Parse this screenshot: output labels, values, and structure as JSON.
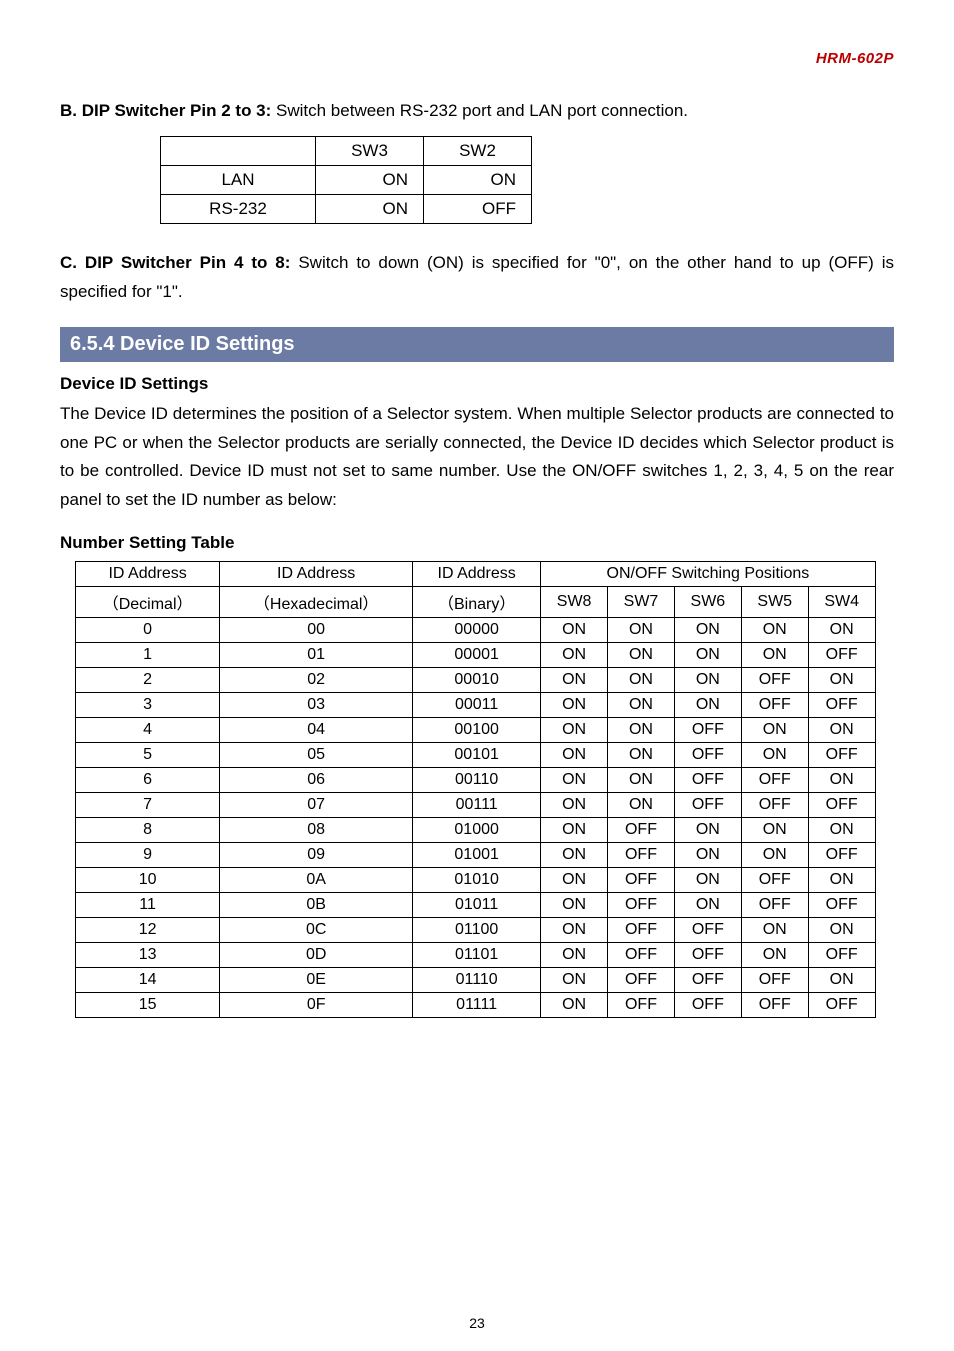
{
  "header": {
    "product": "HRM-602P"
  },
  "sectionB": {
    "title": "B. DIP Switcher Pin 2 to 3: ",
    "desc": "Switch between RS-232 port and LAN port connection.",
    "table": {
      "cols": [
        "",
        "SW3",
        "SW2"
      ],
      "rows": [
        [
          "LAN",
          "ON",
          "ON"
        ],
        [
          "RS-232",
          "ON",
          "OFF"
        ]
      ]
    }
  },
  "sectionC": {
    "title": "C. DIP Switcher Pin 4 to 8: ",
    "desc": "Switch to down (ON) is specified for \"0\", on the other hand to up (OFF) is specified for \"1\"."
  },
  "sectionBar": "6.5.4 Device ID Settings",
  "deviceId": {
    "heading": "Device ID Settings",
    "text": "The Device ID determines the position of a Selector system. When multiple Selector products are connected to one PC or when the Selector products are serially connected, the Device ID decides which Selector product is to be controlled. Device ID must not set to same number. Use the ON/OFF switches 1, 2, 3, 4, 5 on the rear panel to set the ID number as below:"
  },
  "numberTable": {
    "title": "Number Setting Table",
    "header1": [
      "ID Address",
      "ID Address",
      "ID Address",
      "ON/OFF Switching Positions"
    ],
    "header2": [
      "（Decimal）",
      "（Hexadecimal）",
      "（Binary）",
      "SW8",
      "SW7",
      "SW6",
      "SW5",
      "SW4"
    ],
    "rows": [
      [
        "0",
        "00",
        "00000",
        "ON",
        "ON",
        "ON",
        "ON",
        "ON"
      ],
      [
        "1",
        "01",
        "00001",
        "ON",
        "ON",
        "ON",
        "ON",
        "OFF"
      ],
      [
        "2",
        "02",
        "00010",
        "ON",
        "ON",
        "ON",
        "OFF",
        "ON"
      ],
      [
        "3",
        "03",
        "00011",
        "ON",
        "ON",
        "ON",
        "OFF",
        "OFF"
      ],
      [
        "4",
        "04",
        "00100",
        "ON",
        "ON",
        "OFF",
        "ON",
        "ON"
      ],
      [
        "5",
        "05",
        "00101",
        "ON",
        "ON",
        "OFF",
        "ON",
        "OFF"
      ],
      [
        "6",
        "06",
        "00110",
        "ON",
        "ON",
        "OFF",
        "OFF",
        "ON"
      ],
      [
        "7",
        "07",
        "00111",
        "ON",
        "ON",
        "OFF",
        "OFF",
        "OFF"
      ],
      [
        "8",
        "08",
        "01000",
        "ON",
        "OFF",
        "ON",
        "ON",
        "ON"
      ],
      [
        "9",
        "09",
        "01001",
        "ON",
        "OFF",
        "ON",
        "ON",
        "OFF"
      ],
      [
        "10",
        "0A",
        "01010",
        "ON",
        "OFF",
        "ON",
        "OFF",
        "ON"
      ],
      [
        "11",
        "0B",
        "01011",
        "ON",
        "OFF",
        "ON",
        "OFF",
        "OFF"
      ],
      [
        "12",
        "0C",
        "01100",
        "ON",
        "OFF",
        "OFF",
        "ON",
        "ON"
      ],
      [
        "13",
        "0D",
        "01101",
        "ON",
        "OFF",
        "OFF",
        "ON",
        "OFF"
      ],
      [
        "14",
        "0E",
        "01110",
        "ON",
        "OFF",
        "OFF",
        "OFF",
        "ON"
      ],
      [
        "15",
        "0F",
        "01111",
        "ON",
        "OFF",
        "OFF",
        "OFF",
        "OFF"
      ]
    ]
  },
  "pageNumber": "23"
}
